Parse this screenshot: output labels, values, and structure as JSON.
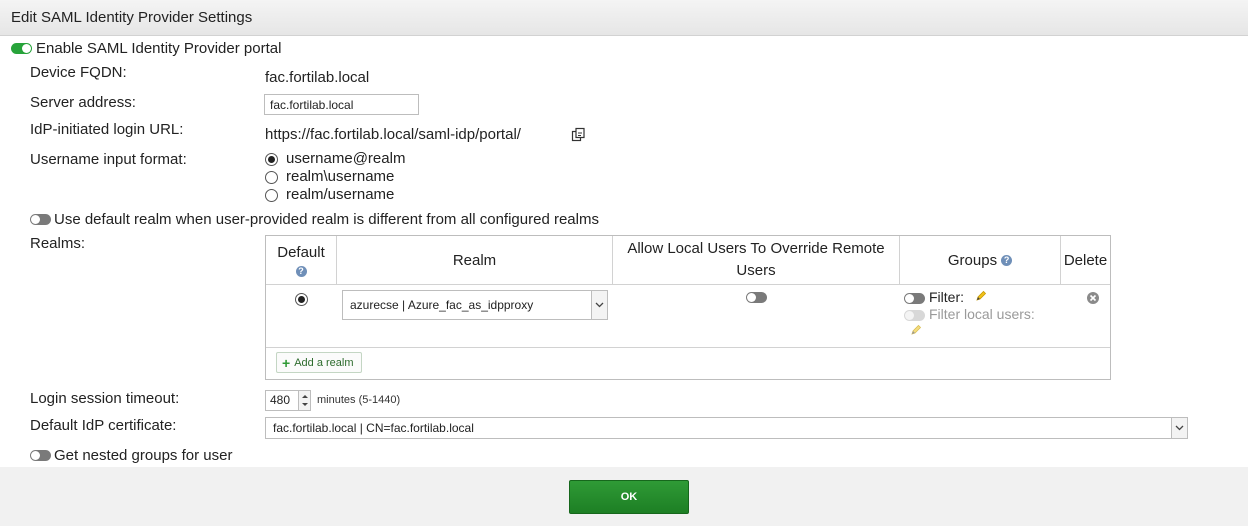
{
  "dialog": {
    "title": "Edit SAML Identity Provider Settings"
  },
  "enable_portal": {
    "label": "Enable SAML Identity Provider portal",
    "on": true
  },
  "device_fqdn": {
    "label": "Device FQDN:",
    "value": "fac.fortilab.local"
  },
  "server_address": {
    "label": "Server address:",
    "value": "fac.fortilab.local"
  },
  "idp_login_url": {
    "label": "IdP-initiated login URL:",
    "value": "https://fac.fortilab.local/saml-idp/portal/"
  },
  "username_format": {
    "label": "Username input format:",
    "options": [
      "username@realm",
      "realm\\username",
      "realm/username"
    ],
    "selected": 0
  },
  "default_realm": {
    "label": "Use default realm when user-provided realm is different from all configured realms",
    "on": false
  },
  "realms": {
    "label": "Realms:",
    "headers": {
      "default": "Default",
      "realm": "Realm",
      "allow_local": "Allow Local Users To Override Remote Users",
      "groups": "Groups",
      "delete": "Delete"
    },
    "rows": [
      {
        "default": true,
        "realm": "azurecse | Azure_fac_as_idpproxy",
        "allow_local": false,
        "filter_label": "Filter:",
        "filter_local_label": "Filter local users:"
      }
    ],
    "add_label": "Add a realm"
  },
  "login_timeout": {
    "label": "Login session timeout:",
    "value": "480",
    "unit": "minutes (5-1440)"
  },
  "idp_certificate": {
    "label": "Default IdP certificate:",
    "value": "fac.fortilab.local | CN=fac.fortilab.local"
  },
  "nested_groups": {
    "label": "Get nested groups for user",
    "on": false
  },
  "footer": {
    "ok_label": "OK"
  },
  "colors": {
    "accent_green": "#27a33a",
    "ok_button": "#1d7f24",
    "help_icon": "#6f8fb8"
  }
}
